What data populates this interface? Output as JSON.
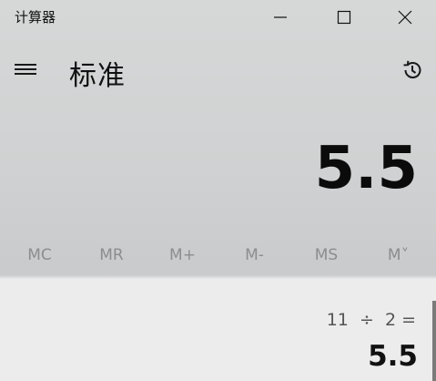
{
  "window": {
    "title": "计算器",
    "controls": [
      "minimize-icon",
      "maximize-icon",
      "close-icon"
    ]
  },
  "header": {
    "menu_icon": "hamburger-menu-icon",
    "mode_title": "标准",
    "history_icon": "history-icon"
  },
  "display": {
    "value": "5.5"
  },
  "memory": {
    "buttons": [
      "MC",
      "MR",
      "M+",
      "M-",
      "MS",
      "M˅"
    ]
  },
  "history": {
    "items": [
      {
        "expression": "11  ÷  2 =",
        "result": "5.5"
      }
    ]
  },
  "colors": {
    "background": "#d3d5d5",
    "history_panel": "#ececec",
    "memory_text": "#8c8d8e",
    "text": "#111111"
  }
}
